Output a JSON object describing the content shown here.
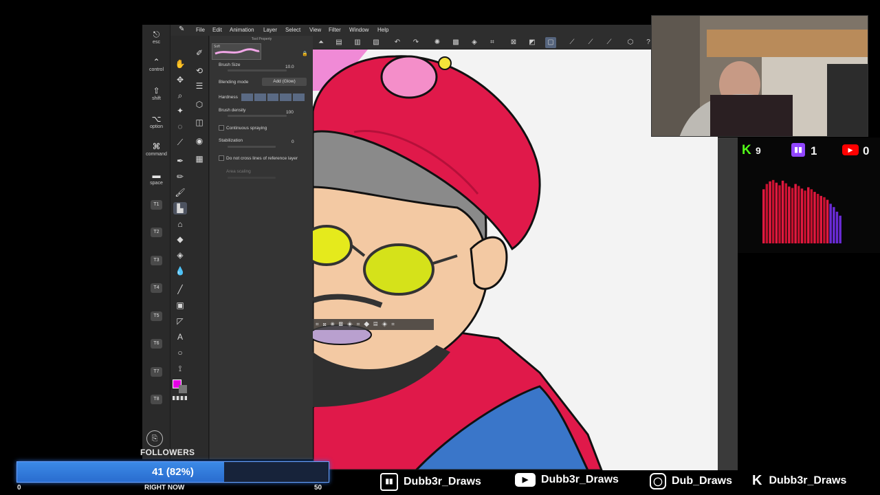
{
  "app": {
    "menu": [
      "File",
      "Edit",
      "Animation",
      "Layer",
      "Select",
      "View",
      "Filter",
      "Window",
      "Help"
    ]
  },
  "modifiers": [
    {
      "label": "esc",
      "icon": "escape-icon"
    },
    {
      "label": "control",
      "icon": "chevron-up-icon"
    },
    {
      "label": "shift",
      "icon": "shift-icon"
    },
    {
      "label": "option",
      "icon": "option-icon"
    },
    {
      "label": "command",
      "icon": "command-icon"
    },
    {
      "label": "space",
      "icon": "space-bar-icon"
    }
  ],
  "tkeys": [
    "T1",
    "T2",
    "T3",
    "T4",
    "T5",
    "T6",
    "T7",
    "T8"
  ],
  "tool_property": {
    "title": "Tool Property",
    "brush_name": "Soft",
    "brush_size_label": "Brush Size",
    "brush_size_value": "10.0",
    "blending_label": "Blending mode",
    "blending_value": "Add (Glow)",
    "hardness_label": "Hardness",
    "density_label": "Brush density",
    "density_value": "100",
    "continuous_label": "Continuous spraying",
    "stabilization_label": "Stabilization",
    "stabilization_value": "0",
    "cross_label": "Do not cross lines of reference layer",
    "area_label": "Area scaling"
  },
  "colors": {
    "main_color": "#e600e6",
    "accent": "#55647d",
    "kick": "#53fc18",
    "twitch": "#9146ff",
    "youtube": "#ff0000",
    "cap": "#e0194a",
    "shirt_blue": "#3a76c9"
  },
  "stats": {
    "kick_count": "9",
    "twitch_count": "1",
    "youtube_count": "0",
    "audio_levels": [
      0.82,
      0.9,
      0.94,
      0.96,
      0.92,
      0.88,
      0.95,
      0.91,
      0.86,
      0.84,
      0.9,
      0.87,
      0.83,
      0.8,
      0.85,
      0.82,
      0.78,
      0.75,
      0.72,
      0.7,
      0.66,
      0.6,
      0.55,
      0.48,
      0.42
    ]
  },
  "followers": {
    "title": "FOLLOWERS",
    "count_text": "41 (82%)",
    "progress": 0.82,
    "min": "0",
    "max": "50",
    "sublabel": "RIGHT NOW"
  },
  "socials": [
    {
      "platform": "twitch",
      "icon": "twitch-icon",
      "handle": "Dubb3r_Draws"
    },
    {
      "platform": "youtube",
      "icon": "youtube-icon",
      "handle": "Dubb3r_Draws"
    },
    {
      "platform": "instagram",
      "icon": "instagram-icon",
      "handle": "Dub_Draws"
    },
    {
      "platform": "kick",
      "icon": "kick-icon",
      "handle": "Dubb3r_Draws"
    }
  ]
}
